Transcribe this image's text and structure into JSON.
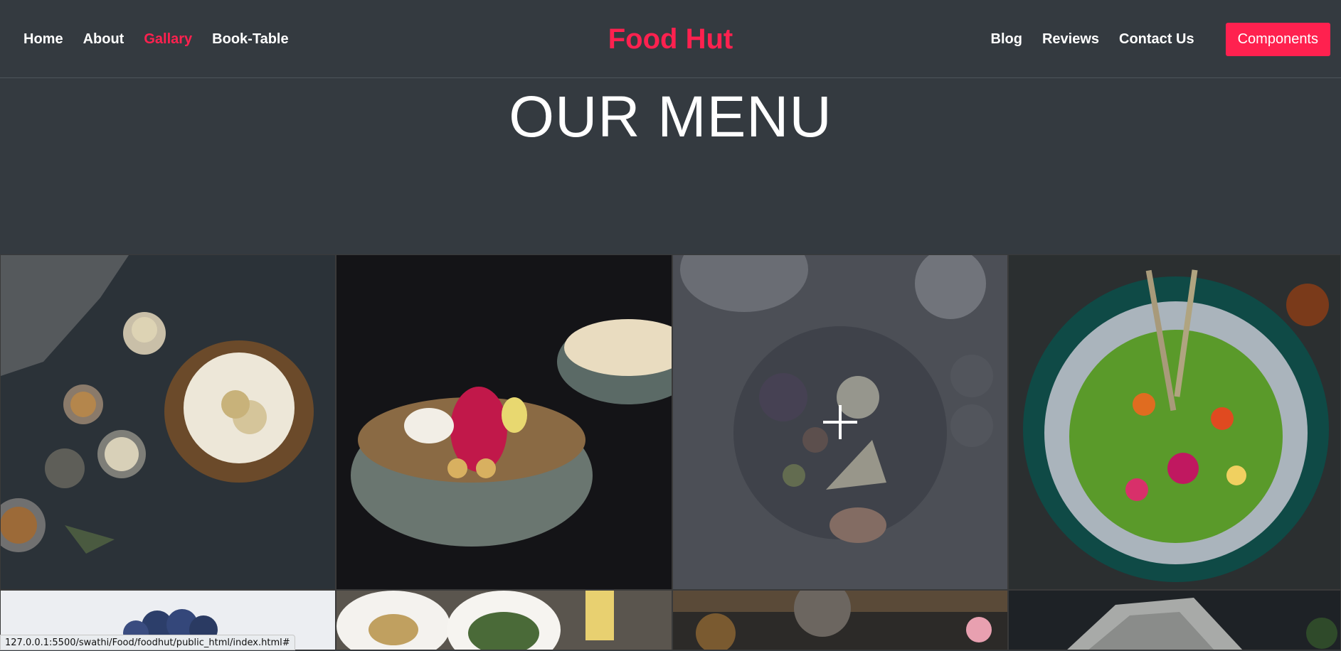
{
  "nav": {
    "left_links": [
      "Home",
      "About",
      "Gallary",
      "Book-Table"
    ],
    "active_link": "Gallary",
    "brand": "Food Hut",
    "right_links": [
      "Blog",
      "Reviews",
      "Contact Us"
    ],
    "components_button": "Components"
  },
  "hero": {
    "title": "OUR MENU"
  },
  "gallery": {
    "items": [
      {
        "name": "dessert-cake-image"
      },
      {
        "name": "granola-bowl-image"
      },
      {
        "name": "cheese-platter-image",
        "hovered": true
      },
      {
        "name": "green-salad-bowl-image"
      },
      {
        "name": "blueberries-image"
      },
      {
        "name": "salad-plates-image"
      },
      {
        "name": "rustic-food-image"
      },
      {
        "name": "lace-cloth-image"
      }
    ]
  },
  "status_bar": {
    "url": "127.0.0.1:5500/swathi/Food/foodhut/public_html/index.html#"
  },
  "colors": {
    "background": "#343a40",
    "accent": "#ff214f",
    "text": "#ffffff"
  }
}
